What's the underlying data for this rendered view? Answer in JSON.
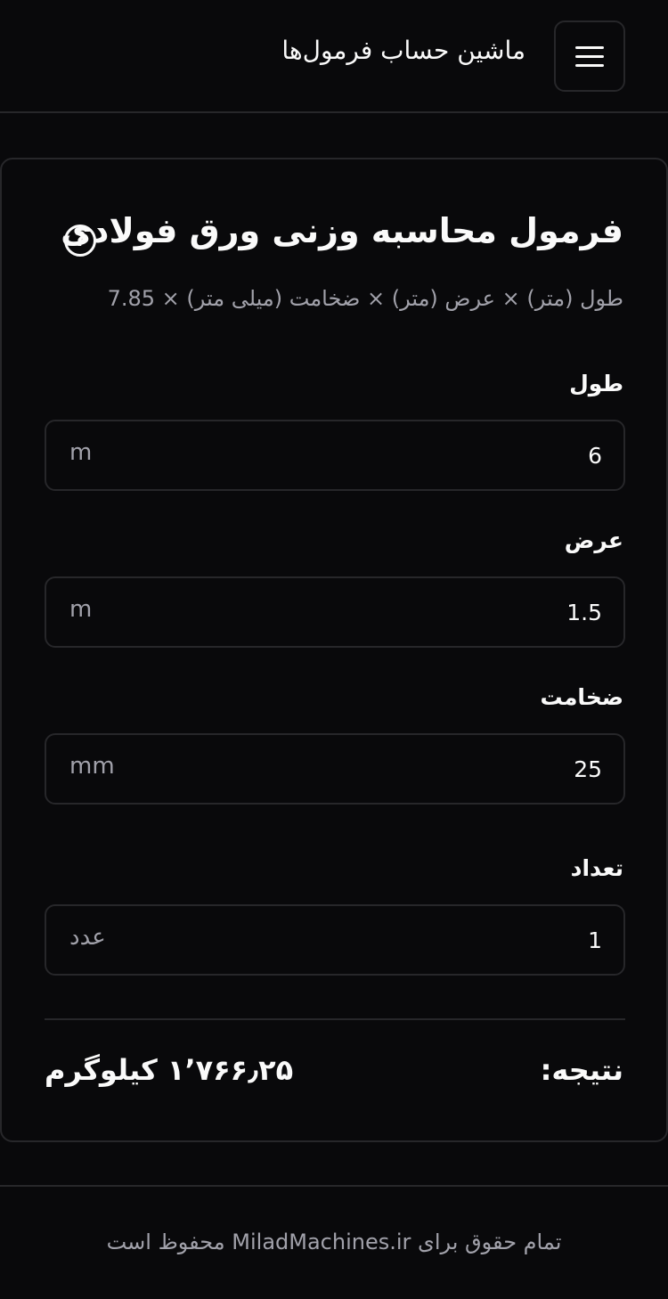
{
  "header": {
    "title": "ماشین حساب فرمول‌ها",
    "menu_icon": "hamburger-menu-icon"
  },
  "calculator": {
    "title": "فرمول محاسبه وزنی ورق فولادی",
    "help_icon": "question-circle-icon",
    "help_glyph": "?",
    "formula": "طول (متر) × عرض (متر) × ضخامت (میلی متر) × 7.85",
    "fields": [
      {
        "label": "طول",
        "value": "6",
        "unit": "m"
      },
      {
        "label": "عرض",
        "value": "1.5",
        "unit": "m"
      },
      {
        "label": "ضخامت",
        "value": "25",
        "unit": "mm"
      },
      {
        "label": "تعداد",
        "value": "1",
        "unit": "عدد"
      }
    ],
    "result_label": "نتیجه:",
    "result_value": "۱٬۷۶۶٫۲۵ کیلوگرم"
  },
  "footer": {
    "text": "تمام حقوق برای MiladMachines.ir محفوظ است"
  },
  "colors": {
    "background": "#09090b",
    "border": "#27272a",
    "text": "#fafafa",
    "muted": "#a1a1aa"
  }
}
